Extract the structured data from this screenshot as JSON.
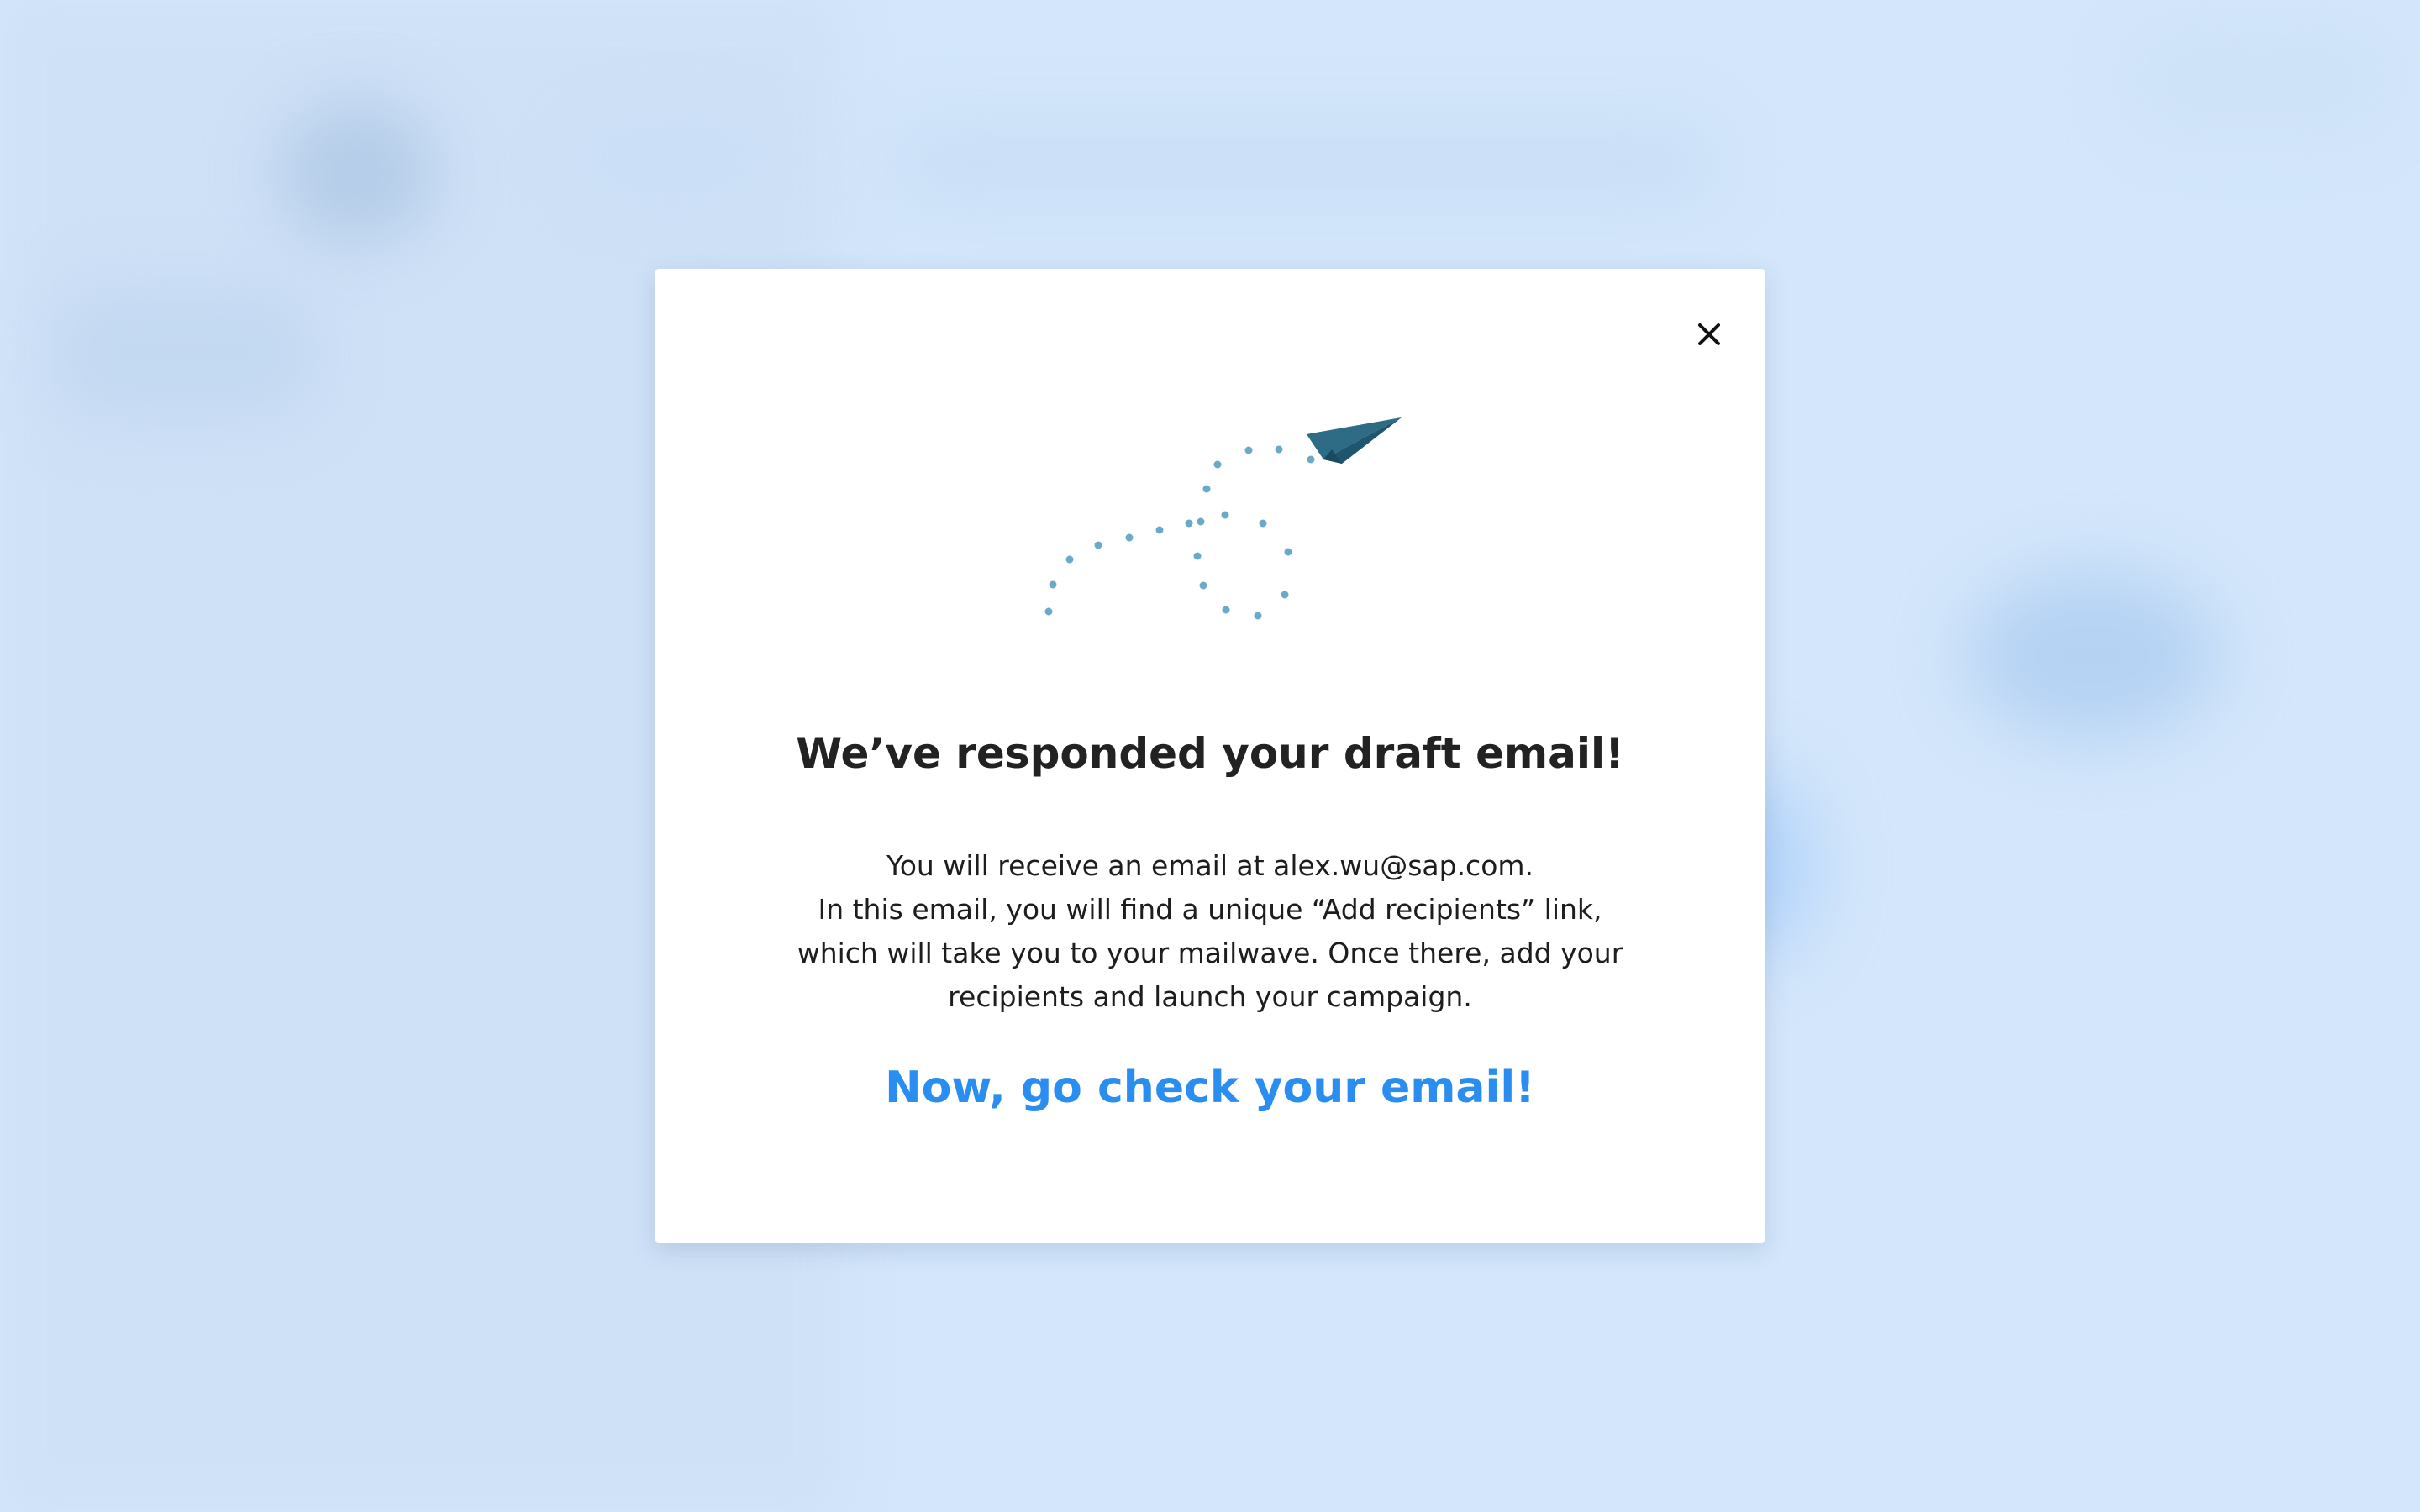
{
  "modal": {
    "title": "We’ve responded your draft email!",
    "body_lines": [
      "You will receive an email at alex.wu@sap.com.",
      "In this email, you will find a unique “Add recipients” link,",
      "which will take you to your mailwave. Once there, add your",
      "recipients and launch your campaign."
    ],
    "cta": "Now, go check your email!",
    "close_icon": "close-icon",
    "illustration_icon": "paper-plane-icon"
  },
  "colors": {
    "backdrop": "#d3e6fb",
    "title": "#222222",
    "body": "#1d1d1d",
    "cta": "#2a8ef0",
    "plane": "#2e6b85",
    "trail": "#6aaac8"
  }
}
